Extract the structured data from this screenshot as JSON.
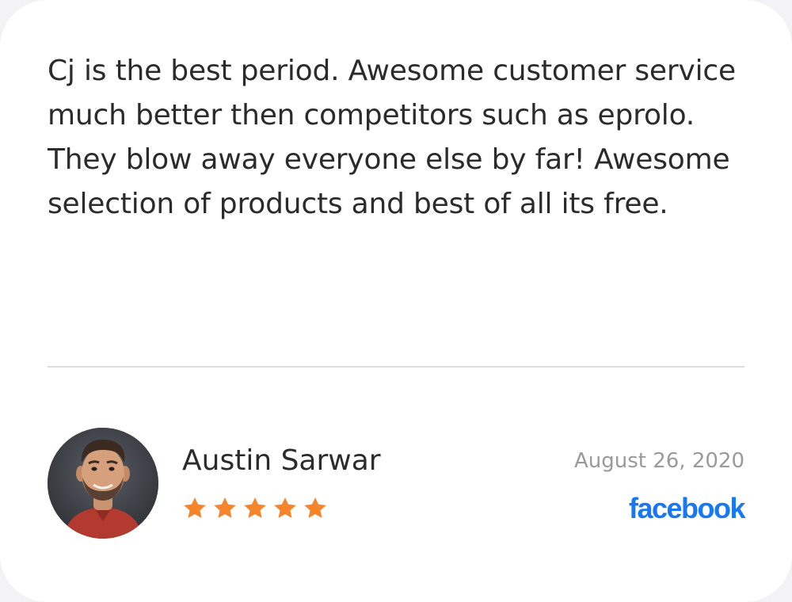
{
  "review": {
    "text": "Cj is the best period. Awesome customer service much better then competitors such as eprolo. They blow away everyone else by far! Awesome selection of products and best of all its free."
  },
  "reviewer": {
    "name": "Austin Sarwar",
    "avatar_icon": "avatar-photo",
    "rating": 5,
    "rating_max": 5
  },
  "meta": {
    "date": "August 26, 2020",
    "source": "facebook",
    "source_icon": "facebook-wordmark-icon"
  },
  "colors": {
    "star": "#F5842A",
    "source": "#1877F2",
    "text": "#2B2B2B",
    "date": "#9A9A9A",
    "divider": "#DDDDDD"
  }
}
